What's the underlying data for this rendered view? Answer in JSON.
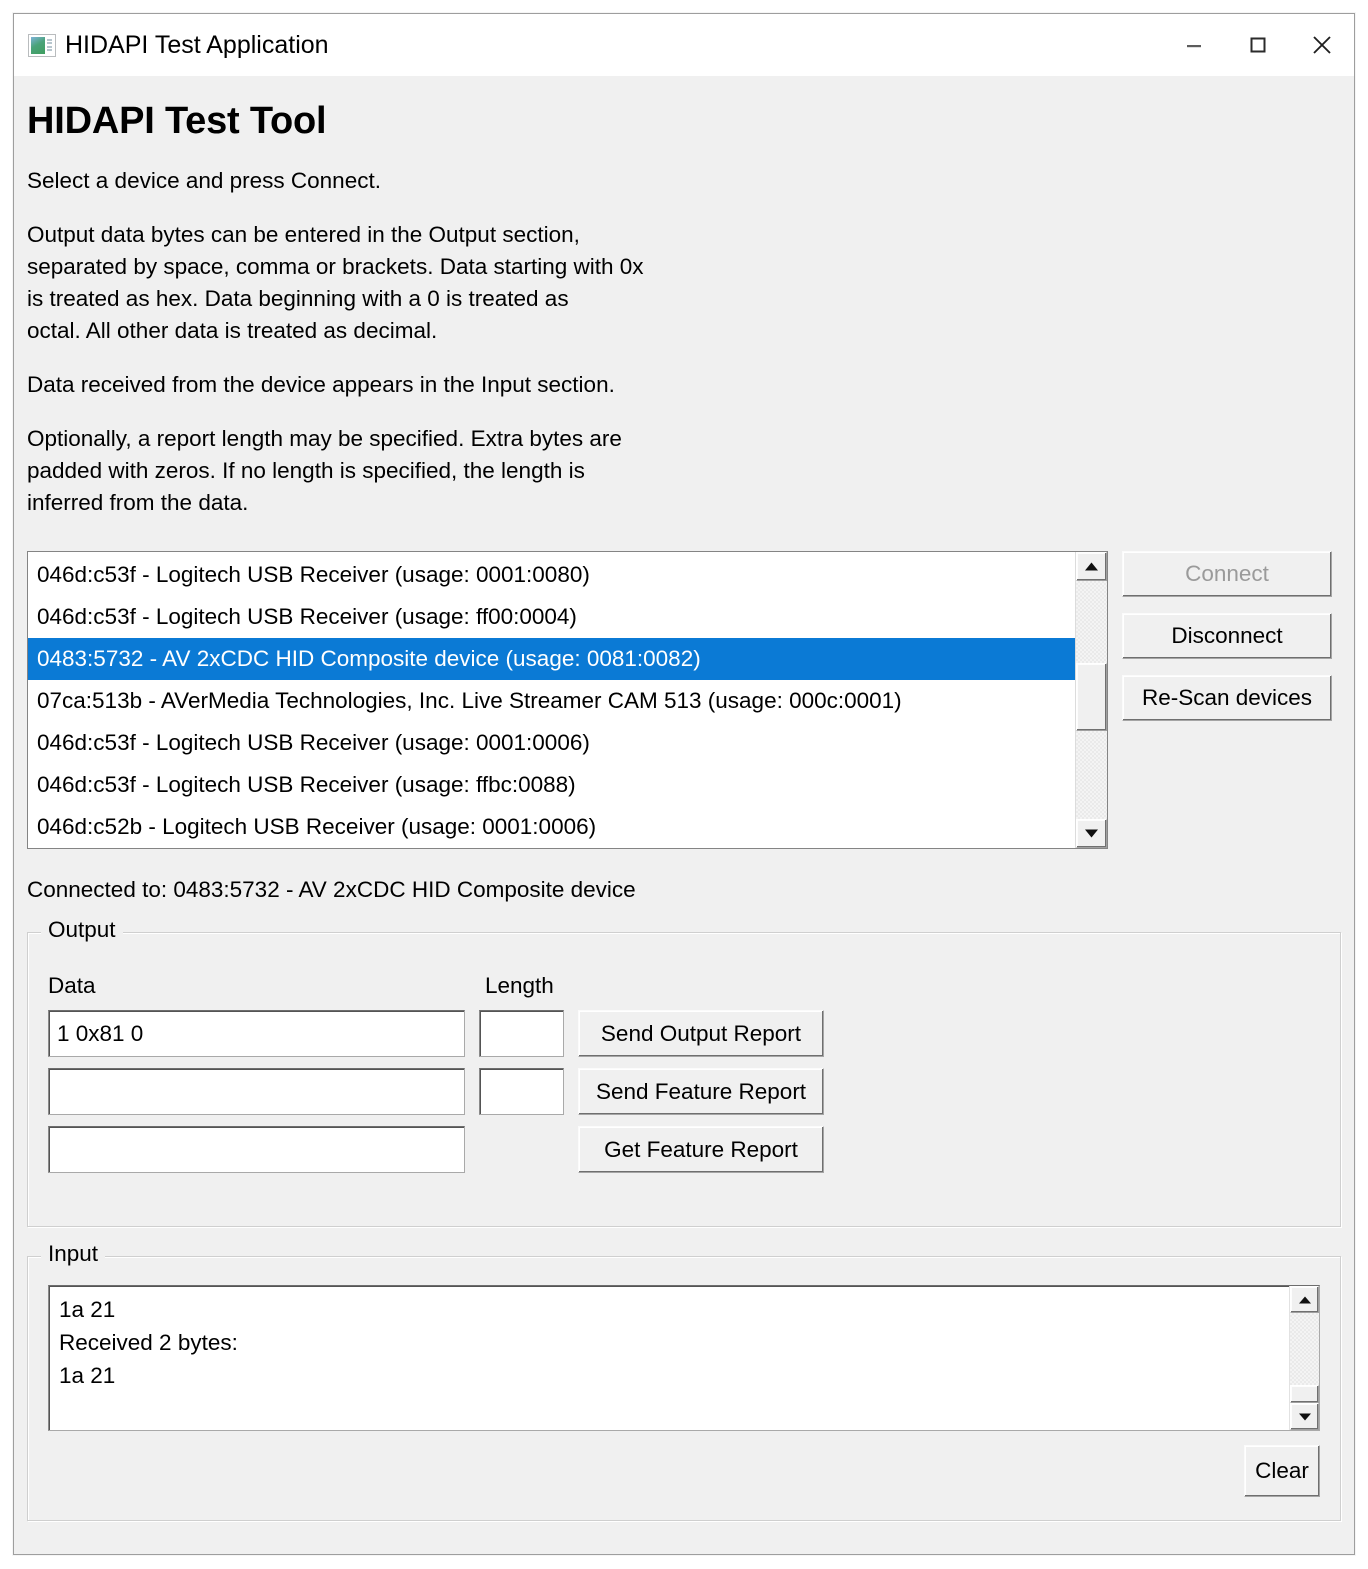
{
  "window": {
    "title": "HIDAPI Test Application",
    "icon": "app-window-icon",
    "controls": {
      "minimize": "minimize-icon",
      "maximize": "maximize-icon",
      "close": "close-icon"
    }
  },
  "page": {
    "heading": "HIDAPI Test Tool",
    "paragraphs": [
      "Select a device and press Connect.",
      "Output data bytes can be entered in the Output section,\nseparated by space, comma or brackets. Data starting with 0x\nis treated as hex. Data beginning with a 0 is treated as\noctal. All other data is treated as decimal.",
      "Data received from the device appears in the Input section.",
      "Optionally, a report length may be specified. Extra bytes are\npadded with zeros. If no length is specified, the length is\ninferred from the data."
    ]
  },
  "device_list": {
    "items": [
      {
        "label": "046d:c53f - Logitech USB Receiver (usage: 0001:0080)",
        "selected": false
      },
      {
        "label": "046d:c53f - Logitech USB Receiver (usage: ff00:0004)",
        "selected": false
      },
      {
        "label": "0483:5732 - AV 2xCDC HID Composite device (usage: 0081:0082)",
        "selected": true
      },
      {
        "label": "07ca:513b - AVerMedia Technologies, Inc. Live Streamer CAM 513 (usage: 000c:0001)",
        "selected": false
      },
      {
        "label": "046d:c53f - Logitech USB Receiver (usage: 0001:0006)",
        "selected": false
      },
      {
        "label": "046d:c53f - Logitech USB Receiver (usage: ffbc:0088)",
        "selected": false
      },
      {
        "label": "046d:c52b - Logitech USB Receiver (usage: 0001:0006)",
        "selected": false
      }
    ],
    "selection_color": "#0b7ad5",
    "scrollbar": {
      "up_icon": "scroll-up-arrow-icon",
      "down_icon": "scroll-down-arrow-icon"
    }
  },
  "device_buttons": {
    "connect": "Connect",
    "connect_disabled": true,
    "disconnect": "Disconnect",
    "rescan": "Re-Scan devices"
  },
  "status": {
    "connected": "Connected to: 0483:5732 - AV 2xCDC HID Composite device"
  },
  "output": {
    "legend": "Output",
    "columns": {
      "data": "Data",
      "length": "Length"
    },
    "rows": [
      {
        "data_value": "1 0x81 0",
        "length_value": "",
        "button": "Send Output Report",
        "has_length": true
      },
      {
        "data_value": "",
        "length_value": "",
        "button": "Send Feature Report",
        "has_length": true
      },
      {
        "data_value": "",
        "length_value": "",
        "button": "Get Feature Report",
        "has_length": false
      }
    ]
  },
  "input": {
    "legend": "Input",
    "text": "1a 21\nReceived 2 bytes:\n1a 21",
    "clear_button": "Clear",
    "scrollbar": {
      "up_icon": "scroll-up-arrow-icon",
      "down_icon": "scroll-down-arrow-icon"
    }
  }
}
